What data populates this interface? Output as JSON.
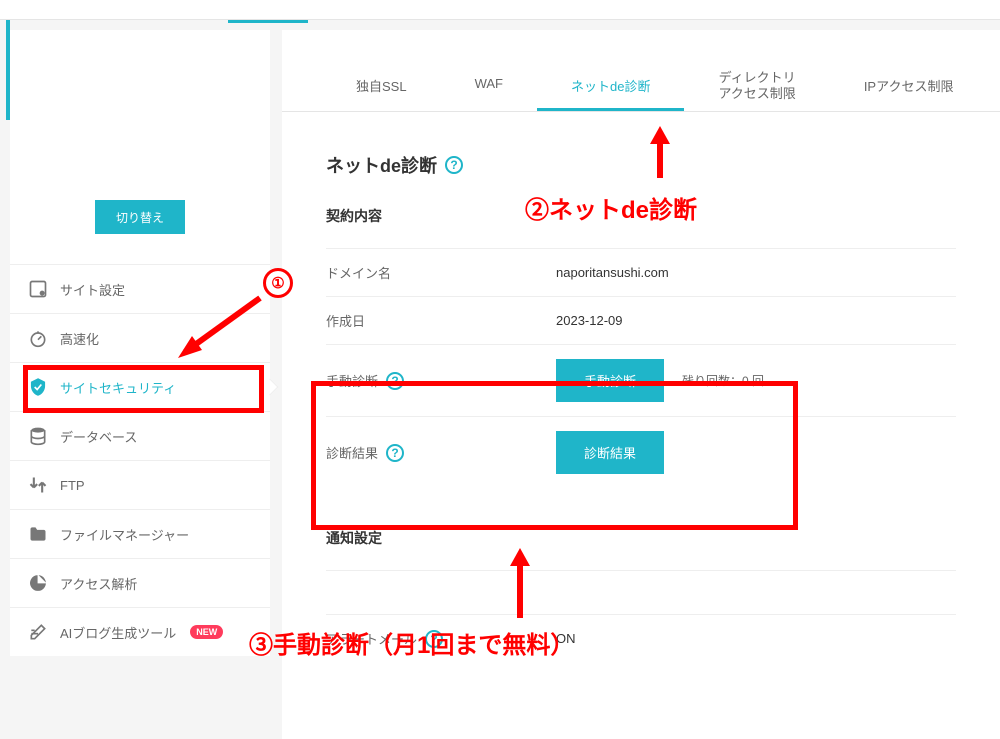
{
  "sidebar": {
    "switch_button": "切り替え",
    "items": [
      {
        "label": "サイト設定",
        "icon": "site-settings-icon"
      },
      {
        "label": "高速化",
        "icon": "speed-icon"
      },
      {
        "label": "サイトセキュリティ",
        "icon": "shield-icon",
        "active": true
      },
      {
        "label": "データベース",
        "icon": "database-icon"
      },
      {
        "label": "FTP",
        "icon": "ftp-icon"
      },
      {
        "label": "ファイルマネージャー",
        "icon": "folder-icon"
      },
      {
        "label": "アクセス解析",
        "icon": "chart-icon"
      },
      {
        "label": "AIブログ生成ツール",
        "icon": "edit-icon",
        "new_badge": "NEW"
      }
    ]
  },
  "tabs": [
    {
      "label": "独自SSL"
    },
    {
      "label": "WAF"
    },
    {
      "label": "ネットde診断",
      "active": true
    },
    {
      "label_l1": "ディレクトリ",
      "label_l2": "アクセス制限"
    },
    {
      "label": "IPアクセス制限"
    }
  ],
  "section": {
    "title": "ネットde診断",
    "sub_contract": "契約内容",
    "domain_label": "ドメイン名",
    "domain_value": "naporitansushi.com",
    "created_label": "作成日",
    "created_value": "2023-12-09",
    "manual_label": "手動診断",
    "manual_button": "手動診断",
    "remaining": "残り回数：0 回",
    "result_label": "診断結果",
    "result_button": "診断結果",
    "notify_title": "通知設定",
    "alert_label": "アラートメール",
    "alert_value": "ON"
  },
  "annotations": {
    "a1": "①",
    "a2_text": "②ネットde診断",
    "a3_text": "③手動診断（月1回まで無料）"
  }
}
